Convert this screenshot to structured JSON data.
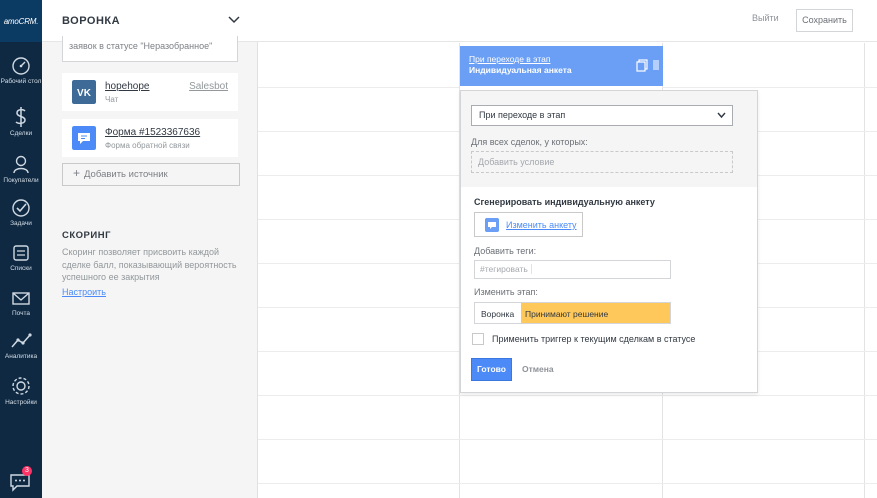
{
  "rail": {
    "logo": "amoCRM.",
    "items": [
      {
        "label": "Рабочий стол",
        "icon": "dashboard-icon"
      },
      {
        "label": "Сделки",
        "icon": "dollar-icon"
      },
      {
        "label": "Покупатели",
        "icon": "customers-icon"
      },
      {
        "label": "Задачи",
        "icon": "tasks-check-icon"
      },
      {
        "label": "Списки",
        "icon": "lists-icon"
      },
      {
        "label": "Почта",
        "icon": "mail-icon"
      },
      {
        "label": "Аналитика",
        "icon": "analytics-icon"
      },
      {
        "label": "Настройки",
        "icon": "settings-icon"
      }
    ],
    "chat_badge": "3"
  },
  "panel": {
    "title": "ВОРОНКА",
    "source_top_text": "заявок в статусе \"Неразобранное\"",
    "sources": [
      {
        "name": "hopehope",
        "sub": "Чат",
        "bot": "Salesbot",
        "icon": "vk-icon"
      },
      {
        "name": "Форма #1523367636",
        "sub": "Форма обратной связи",
        "bot": "",
        "icon": "form-icon"
      }
    ],
    "add_source": "Добавить источник",
    "scoring": {
      "title": "СКОРИНГ",
      "text": "Скоринг позволяет присвоить каждой сделке балл, показывающий вероятность успешного ее закрытия",
      "link": "Настроить"
    }
  },
  "topbar": {
    "exit": "Выйти",
    "save": "Сохранить"
  },
  "trigger": {
    "line1": "При переходе в этап",
    "line2": "Индивидуальная анкета"
  },
  "popup": {
    "select_value": "При переходе в этап",
    "all_deals_label": "Для всех сделок, у которых:",
    "add_condition": "Добавить условие",
    "generate_title": "Сгенерировать индивидуальную анкету",
    "change_form": "Изменить анкету",
    "tags_label": "Добавить теги:",
    "tags_placeholder": "#тегировать",
    "stage_label": "Изменить этап:",
    "pipeline": "Воронка",
    "stage": "Принимают решение",
    "apply_label": "Применить триггер к текущим сделкам в статусе",
    "done": "Готово",
    "cancel": "Отмена"
  },
  "colors": {
    "rail": "#0f2942",
    "accent": "#4c8bf7",
    "trigger": "#6a9ff5",
    "stage": "#ffc85a"
  }
}
